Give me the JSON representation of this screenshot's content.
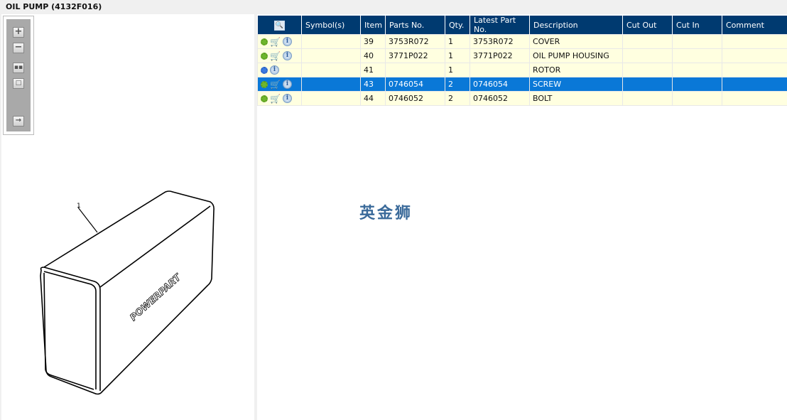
{
  "title": "OIL PUMP (4132F016)",
  "watermark": "英金狮",
  "diagram": {
    "callout": "1",
    "logo_text": "POWERPART"
  },
  "table": {
    "headers": [
      "",
      "Symbol(s)",
      "Item",
      "Parts No.",
      "Qty.",
      "Latest Part No.",
      "Description",
      "Cut Out",
      "Cut In",
      "Comment"
    ],
    "rows": [
      {
        "icons": [
          "gear",
          "cart",
          "info"
        ],
        "symbol": "",
        "item": "39",
        "part": "3753R072",
        "qty": "1",
        "latest": "3753R072",
        "desc": "COVER",
        "cut_out": "",
        "cut_in": "",
        "comment": ""
      },
      {
        "icons": [
          "gear",
          "cart",
          "info"
        ],
        "symbol": "",
        "item": "40",
        "part": "3771P022",
        "qty": "1",
        "latest": "3771P022",
        "desc": "OIL PUMP HOUSING",
        "cut_out": "",
        "cut_in": "",
        "comment": ""
      },
      {
        "icons": [
          "gears",
          "info"
        ],
        "symbol": "",
        "item": "41",
        "part": "",
        "qty": "1",
        "latest": "",
        "desc": "ROTOR",
        "cut_out": "",
        "cut_in": "",
        "comment": ""
      },
      {
        "icons": [
          "gear",
          "cart",
          "info"
        ],
        "symbol": "",
        "item": "43",
        "part": "0746054",
        "qty": "2",
        "latest": "0746054",
        "desc": "SCREW",
        "cut_out": "",
        "cut_in": "",
        "comment": "",
        "selected": true
      },
      {
        "icons": [
          "gear",
          "cart",
          "info"
        ],
        "symbol": "",
        "item": "44",
        "part": "0746052",
        "qty": "2",
        "latest": "0746052",
        "desc": "BOLT",
        "cut_out": "",
        "cut_in": "",
        "comment": ""
      }
    ]
  }
}
